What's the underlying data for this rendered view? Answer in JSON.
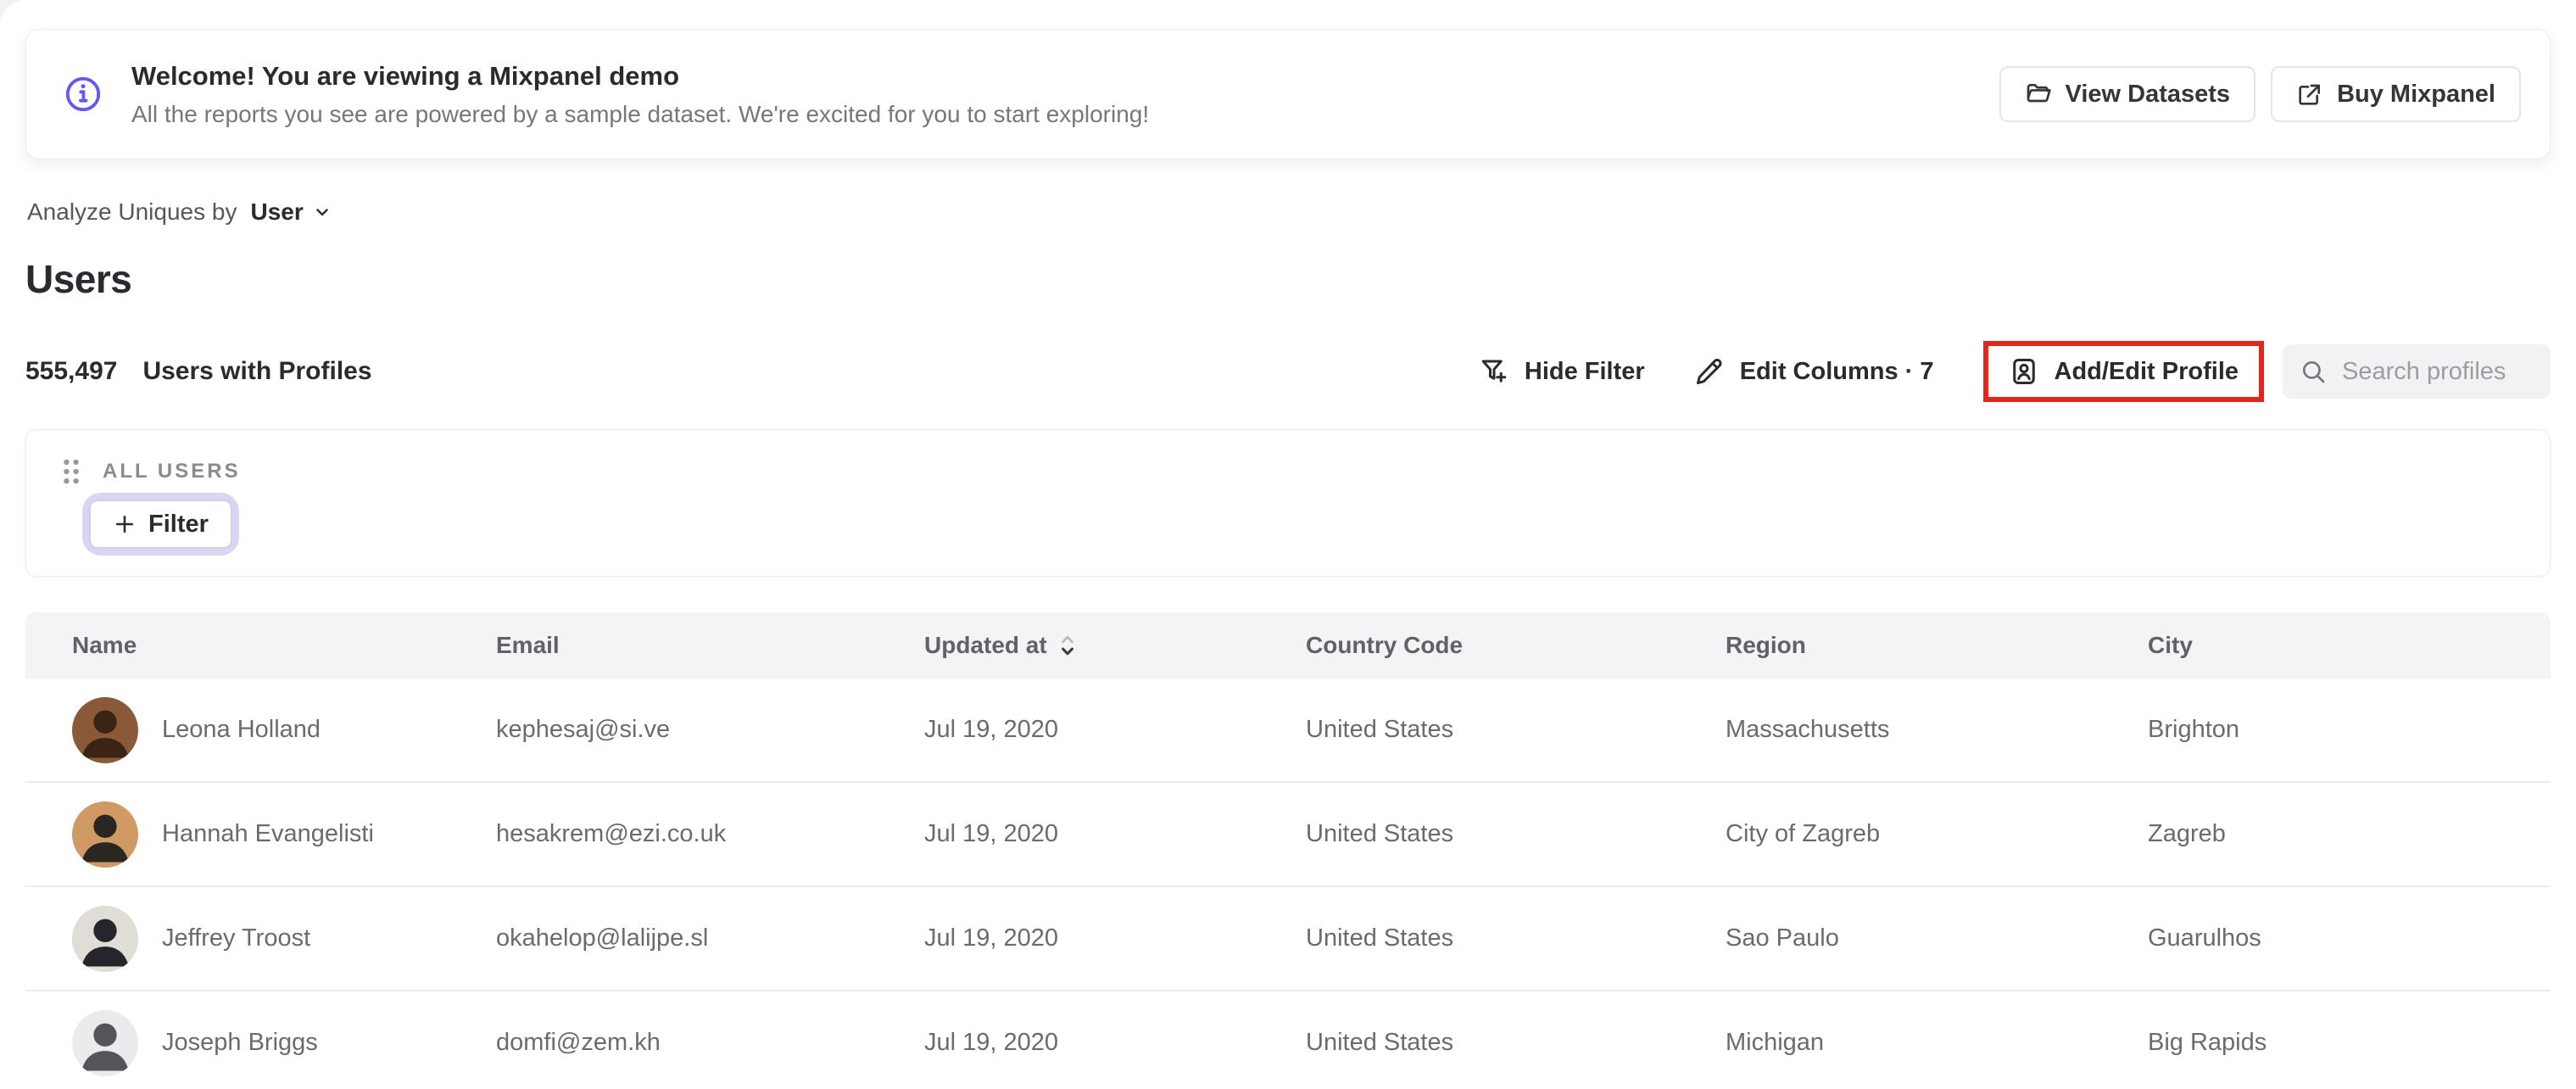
{
  "banner": {
    "title": "Welcome! You are viewing a Mixpanel demo",
    "subtitle": "All the reports you see are powered by a sample dataset. We're excited for you to start exploring!",
    "buttons": [
      {
        "label": "View Datasets",
        "icon": "folder-icon"
      },
      {
        "label": "Buy Mixpanel",
        "icon": "external-link-icon"
      }
    ]
  },
  "controls": {
    "analyze_label": "Analyze Uniques by",
    "analyze_value": "User"
  },
  "page_title": "Users",
  "summary": {
    "count": "555,497",
    "label": "Users with Profiles"
  },
  "toolbar": {
    "hide_filter": "Hide Filter",
    "edit_columns": "Edit Columns · 7",
    "add_edit_profile": "Add/Edit Profile",
    "search_placeholder": "Search profiles"
  },
  "filter_panel": {
    "group_label": "ALL USERS",
    "filter_button": "Filter"
  },
  "table": {
    "columns": [
      "Name",
      "Email",
      "Updated at",
      "Country Code",
      "Region",
      "City"
    ],
    "sorted_column": "Updated at",
    "sort_direction": "desc",
    "rows": [
      {
        "name": "Leona Holland",
        "email": "kephesaj@si.ve",
        "updated_at": "Jul 19, 2020",
        "country": "United States",
        "region": "Massachusetts",
        "city": "Brighton",
        "avatar_bg": "#8a5a38",
        "avatar_fg": "#3a2414"
      },
      {
        "name": "Hannah Evangelisti",
        "email": "hesakrem@ezi.co.uk",
        "updated_at": "Jul 19, 2020",
        "country": "United States",
        "region": "City of Zagreb",
        "city": "Zagreb",
        "avatar_bg": "#d09a64",
        "avatar_fg": "#2a2722"
      },
      {
        "name": "Jeffrey Troost",
        "email": "okahelop@lalijpe.sl",
        "updated_at": "Jul 19, 2020",
        "country": "United States",
        "region": "Sao Paulo",
        "city": "Guarulhos",
        "avatar_bg": "#e0dcd6",
        "avatar_fg": "#26252b"
      },
      {
        "name": "Joseph Briggs",
        "email": "domfi@zem.kh",
        "updated_at": "Jul 19, 2020",
        "country": "United States",
        "region": "Michigan",
        "city": "Big Rapids",
        "avatar_bg": "#ebeaec",
        "avatar_fg": "#56535b"
      }
    ]
  },
  "colors": {
    "accent_purple": "#6158f5",
    "highlight_red": "#e3251c",
    "focus_ring_lavender": "#d9d5f7"
  }
}
